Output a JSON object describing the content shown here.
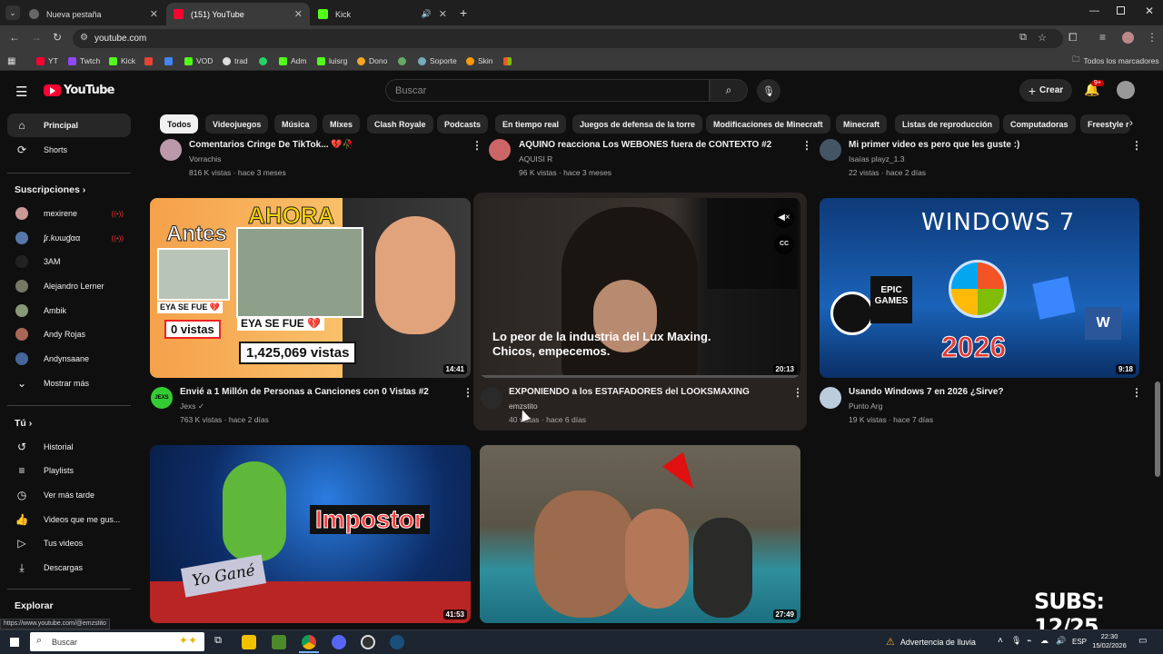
{
  "browser": {
    "tabs": [
      {
        "title": "Nueva pestaña"
      },
      {
        "title": "(151) YouTube"
      },
      {
        "title": "Kick"
      }
    ],
    "url": "youtube.com",
    "bookmarks": [
      "YT",
      "Twtch",
      "Kick",
      "VOD",
      "trad",
      "Adm",
      "luisrg",
      "Dono",
      "Soporte",
      "Skin"
    ],
    "all_bookmarks": "Todos los marcadores"
  },
  "header": {
    "logo": "YouTube",
    "search_placeholder": "Buscar",
    "create_label": "Crear",
    "notifications_badge": "9+"
  },
  "chips": [
    "Todos",
    "Videojuegos",
    "Música",
    "Mixes",
    "Clash Royale",
    "Podcasts",
    "En tiempo real",
    "Juegos de defensa de la torre",
    "Modificaciones de Minecraft",
    "Minecraft",
    "Listas de reproducción",
    "Computadoras",
    "Freestyle r"
  ],
  "sidebar": {
    "main": [
      {
        "label": "Principal"
      },
      {
        "label": "Shorts"
      }
    ],
    "subs_heading": "Suscripciones",
    "subs": [
      {
        "label": "mexirene"
      },
      {
        "label": "ʄɾ.ƙυɯɠαα"
      },
      {
        "label": "3AM"
      },
      {
        "label": "Alejandro Lerner"
      },
      {
        "label": "Ambik"
      },
      {
        "label": "Andy Rojas"
      },
      {
        "label": "Andynsaane"
      },
      {
        "label": "Mostrar más"
      }
    ],
    "you_heading": "Tú",
    "you": [
      {
        "label": "Historial"
      },
      {
        "label": "Playlists"
      },
      {
        "label": "Ver más tarde"
      },
      {
        "label": "Videos que me gus..."
      },
      {
        "label": "Tus videos"
      },
      {
        "label": "Descargas"
      }
    ],
    "explore_heading": "Explorar"
  },
  "top_row": [
    {
      "title": "Comentarios Cringe De TikTok... 💔🥀",
      "channel": "Vorrachis",
      "meta": "816 K vistas · hace 3 meses"
    },
    {
      "title": "AQUINO reacciona Los WEBONES fuera de CONTEXTO #2",
      "channel": "AQUISI R",
      "meta": "96 K vistas · hace 3 meses"
    },
    {
      "title": "Mi primer video es pero que les guste :)",
      "channel": "Isaías playz_1.3",
      "meta": "22 vistas · hace 2 días"
    }
  ],
  "mid_row": [
    {
      "title": "Envié a 1 Millón de Personas a Canciones con 0 Vistas #2",
      "channel": "Jexs",
      "meta": "763 K vistas · hace 2 días",
      "duration": "14:41",
      "thumb": {
        "antes": "Antes",
        "ahora": "AHORA",
        "eya1": "EYA SE FUE 💔",
        "zero": "0 vistas",
        "eya2": "EYA SE FUE 💔",
        "million": "1,425,069 vistas"
      }
    },
    {
      "title": "EXPONIENDO a los ESTAFADORES del LOOKSMAXING",
      "channel": "emzstito",
      "meta": "40 vistas · hace 6 días",
      "duration": "20:13",
      "caption": "Lo peor de la industria del Lux Maxing. Chicos, empecemos."
    },
    {
      "title": "Usando Windows 7 en 2026 ¿Sirve?",
      "channel": "Punto Arg",
      "meta": "19 K vistas · hace 7 días",
      "duration": "9:18",
      "thumb": {
        "top": "WINDOWS 7",
        "epic": "EPIC GAMES",
        "year": "2026"
      }
    }
  ],
  "bottom_row": [
    {
      "duration": "41:53",
      "thumb": {
        "impostor": "Impostor",
        "sign": "Yo Gané"
      }
    },
    {
      "duration": "27:49"
    }
  ],
  "status_url": "https://www.youtube.com/@emzstito",
  "overlay_subs": "SUBS: 12/25",
  "taskbar": {
    "search": "Buscar",
    "weather": "Advertencia de lluvia",
    "lang": "ESP",
    "time": "22:30",
    "date": "15/02/2026"
  },
  "colors": {
    "yt_red": "#ff0033",
    "bg": "#0f0f0f",
    "chip": "#272727"
  }
}
